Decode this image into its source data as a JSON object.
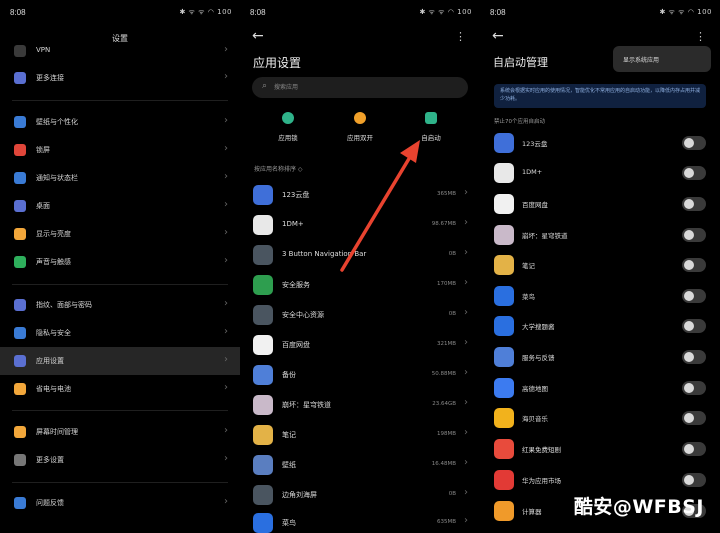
{
  "status_time": "8:08",
  "status_icons": "✱ ᯤ ᯤ ◠ 100",
  "settings": {
    "title": "设置",
    "items": [
      {
        "label": "VPN",
        "color": "#3a3a3a"
      },
      {
        "label": "更多连接",
        "color": "#5a6fd1"
      },
      {
        "label": "壁纸与个性化",
        "color": "#3a7bd5"
      },
      {
        "label": "锁屏",
        "color": "#e0463a"
      },
      {
        "label": "通知与状态栏",
        "color": "#3a7bd5"
      },
      {
        "label": "桌面",
        "color": "#5a6fd1"
      },
      {
        "label": "显示与亮度",
        "color": "#f2a73b"
      },
      {
        "label": "声音与触感",
        "color": "#2eaf5c"
      },
      {
        "label": "指纹、面部与密码",
        "color": "#5a6fd1"
      },
      {
        "label": "隐私与安全",
        "color": "#3a7bd5"
      },
      {
        "label": "应用设置",
        "color": "#5a6fd1"
      },
      {
        "label": "省电与电池",
        "color": "#f2a73b"
      },
      {
        "label": "屏幕时间管理",
        "color": "#f2a73b"
      },
      {
        "label": "更多设置",
        "color": "#777777"
      },
      {
        "label": "问题反馈",
        "color": "#3a7bd5"
      }
    ]
  },
  "app_settings": {
    "title": "应用设置",
    "search_placeholder": "搜索应用",
    "quick": [
      {
        "label": "应用锁",
        "color": "#2fb38a"
      },
      {
        "label": "应用双开",
        "color": "#f0a02a"
      },
      {
        "label": "自启动",
        "color": "#2fb38a"
      }
    ],
    "sort_label": "按应用名称排序 ◇",
    "apps": [
      {
        "name": "123云盘",
        "size": "365MB",
        "color": "#3f6fd9"
      },
      {
        "name": "1DM+",
        "size": "98.67MB",
        "color": "#e8e8e8"
      },
      {
        "name": "3 Button Navigation Bar",
        "size": "0B",
        "color": "#4a5560"
      },
      {
        "name": "安全服务",
        "size": "170MB",
        "color": "#2e9e4f"
      },
      {
        "name": "安全中心资源",
        "size": "0B",
        "color": "#4a5560"
      },
      {
        "name": "百度网盘",
        "size": "321MB",
        "color": "#f1f1f1"
      },
      {
        "name": "备份",
        "size": "50.88MB",
        "color": "#4f7fd8"
      },
      {
        "name": "崩坏：星穹铁道",
        "size": "23.64GB",
        "color": "#c9b9c9"
      },
      {
        "name": "笔记",
        "size": "198MB",
        "color": "#e3b247"
      },
      {
        "name": "壁纸",
        "size": "16.48MB",
        "color": "#5a7ec0"
      },
      {
        "name": "边角刘海屏",
        "size": "0B",
        "color": "#4a5560"
      },
      {
        "name": "菜鸟",
        "size": "635MB",
        "color": "#2a6fe0"
      }
    ]
  },
  "autostart": {
    "title": "自启动管理",
    "popup_label": "显示系统应用",
    "notice": "系统会根据实时应用的使用情况，智能优化不常用应用的自启动功能，以降低内存占用并减少功耗。",
    "count_label": "禁止70个应用自启动",
    "apps": [
      {
        "name": "123云盘",
        "color": "#3f6fd9"
      },
      {
        "name": "1DM+",
        "color": "#e8e8e8"
      },
      {
        "name": "百度网盘",
        "color": "#f1f1f1"
      },
      {
        "name": "崩坏：星穹铁道",
        "color": "#c9b9c9"
      },
      {
        "name": "笔记",
        "color": "#e3b247"
      },
      {
        "name": "菜鸟",
        "color": "#2a6fe0"
      },
      {
        "name": "大学搜题酱",
        "color": "#2a6fe0"
      },
      {
        "name": "服务与反馈",
        "color": "#4f7fd8"
      },
      {
        "name": "高德地图",
        "color": "#3c7bf0"
      },
      {
        "name": "海贝音乐",
        "color": "#f2b21c"
      },
      {
        "name": "红果免费短剧",
        "color": "#e84b3c"
      },
      {
        "name": "华为应用市场",
        "color": "#e23a35"
      },
      {
        "name": "计算器",
        "color": "#f09a2a"
      }
    ]
  },
  "watermark": "酷安@WFBSJ"
}
